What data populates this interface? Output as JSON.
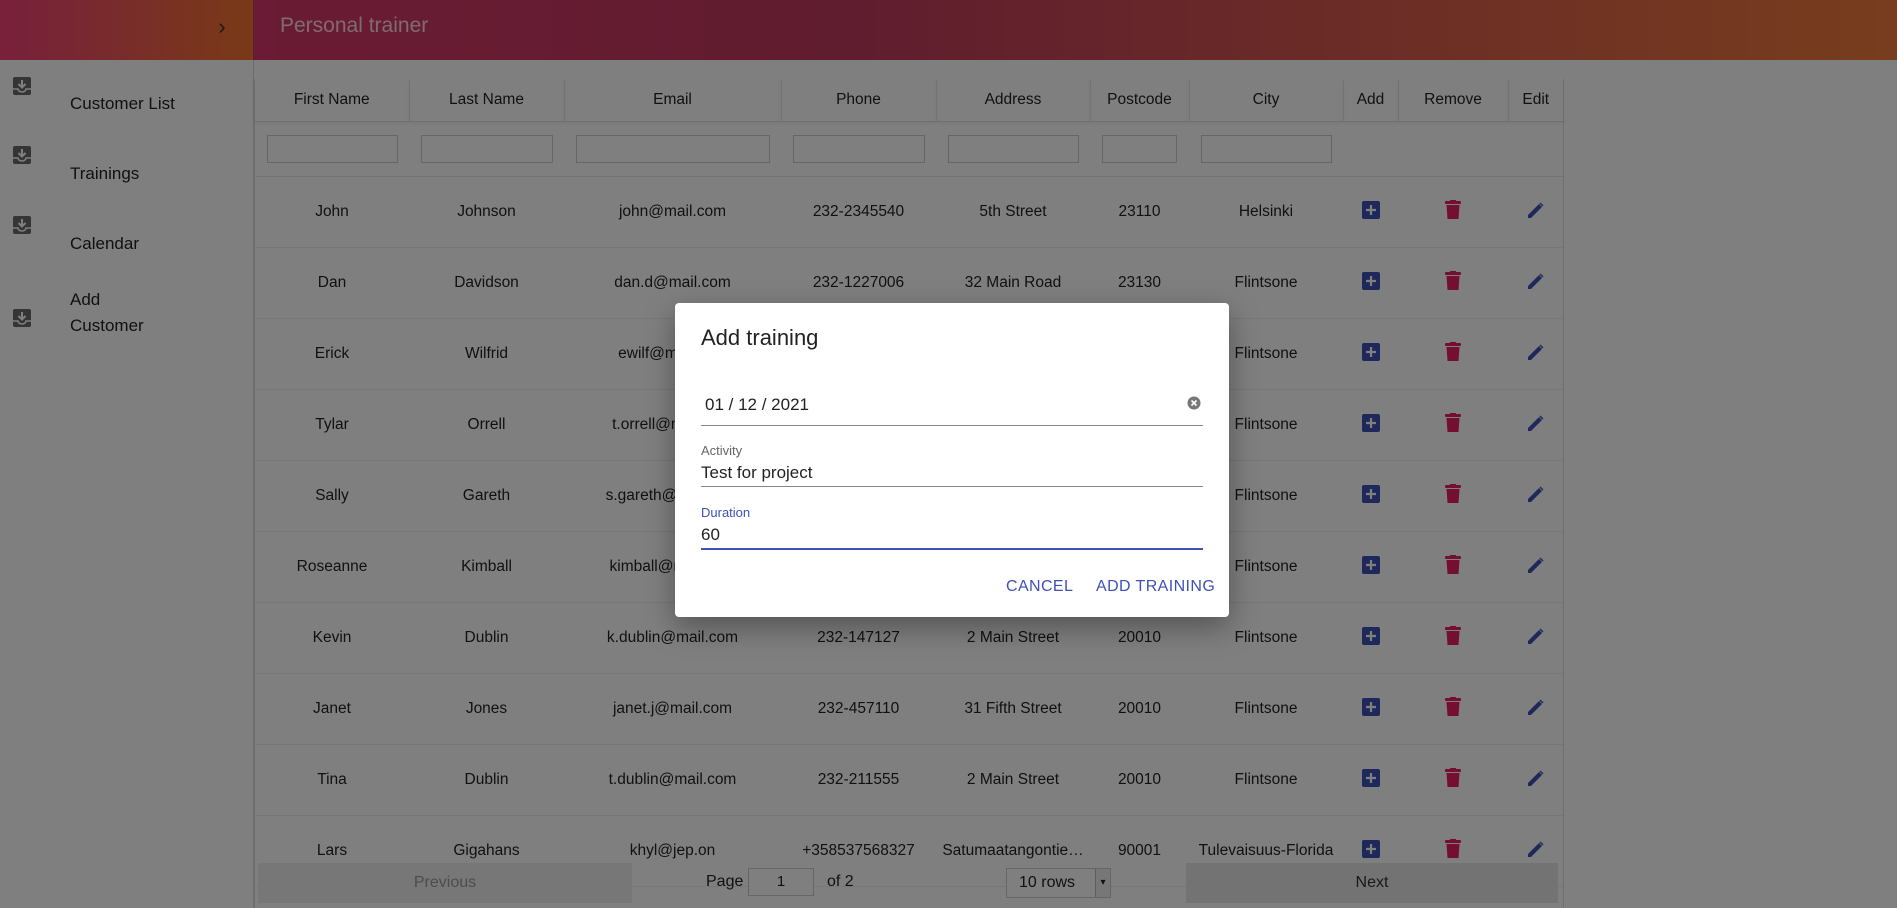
{
  "app": {
    "title": "Personal trainer"
  },
  "sidebar": {
    "items": [
      {
        "label": "Customer List"
      },
      {
        "label": "Trainings"
      },
      {
        "label": "Calendar"
      },
      {
        "label_line1": "Add",
        "label_line2": "Customer"
      }
    ]
  },
  "table": {
    "headers": [
      "First Name",
      "Last Name",
      "Email",
      "Phone",
      "Address",
      "Postcode",
      "City",
      "Add",
      "Remove",
      "Edit"
    ],
    "rows": [
      [
        "John",
        "Johnson",
        "john@mail.com",
        "232-2345540",
        "5th Street",
        "23110",
        "Helsinki"
      ],
      [
        "Dan",
        "Davidson",
        "dan.d@mail.com",
        "232-1227006",
        "32 Main Road",
        "23130",
        "Flintsone"
      ],
      [
        "Erick",
        "Wilfrid",
        "ewilf@mail.com",
        "",
        "",
        "",
        "Flintsone"
      ],
      [
        "Tylar",
        "Orrell",
        "t.orrell@mail.com",
        "",
        "",
        "",
        "Flintsone"
      ],
      [
        "Sally",
        "Gareth",
        "s.gareth@mail.com",
        "",
        "",
        "",
        "Flintsone"
      ],
      [
        "Roseanne",
        "Kimball",
        "kimball@mail.com",
        "",
        "",
        "",
        "Flintsone"
      ],
      [
        "Kevin",
        "Dublin",
        "k.dublin@mail.com",
        "232-147127",
        "2 Main Street",
        "20010",
        "Flintsone"
      ],
      [
        "Janet",
        "Jones",
        "janet.j@mail.com",
        "232-457110",
        "31 Fifth Street",
        "20010",
        "Flintsone"
      ],
      [
        "Tina",
        "Dublin",
        "t.dublin@mail.com",
        "232-211555",
        "2 Main Street",
        "20010",
        "Flintsone"
      ],
      [
        "Lars",
        "Gigahans",
        "khyl@jep.on",
        "+358537568327",
        "Satumaatangontie…",
        "90001",
        "Tulevaisuus-Florida"
      ]
    ]
  },
  "pagination": {
    "previous": "Previous",
    "page_label": "Page",
    "page_value": "1",
    "of_label": "of 2",
    "rows_option": "10 rows",
    "next": "Next"
  },
  "dialog": {
    "title": "Add training",
    "date_value": "01 / 12 / 2021",
    "activity_label": "Activity",
    "activity_value": "Test for project",
    "duration_label": "Duration",
    "duration_value": "60",
    "cancel": "CANCEL",
    "submit": "ADD TRAINING"
  },
  "colors": {
    "header_gradient": [
      "#e0356f",
      "#f07b3c"
    ],
    "add_icon": "#3f51b5",
    "remove_icon": "#e91e63",
    "edit_icon": "#3f51b5",
    "focus": "#3f51b5"
  }
}
